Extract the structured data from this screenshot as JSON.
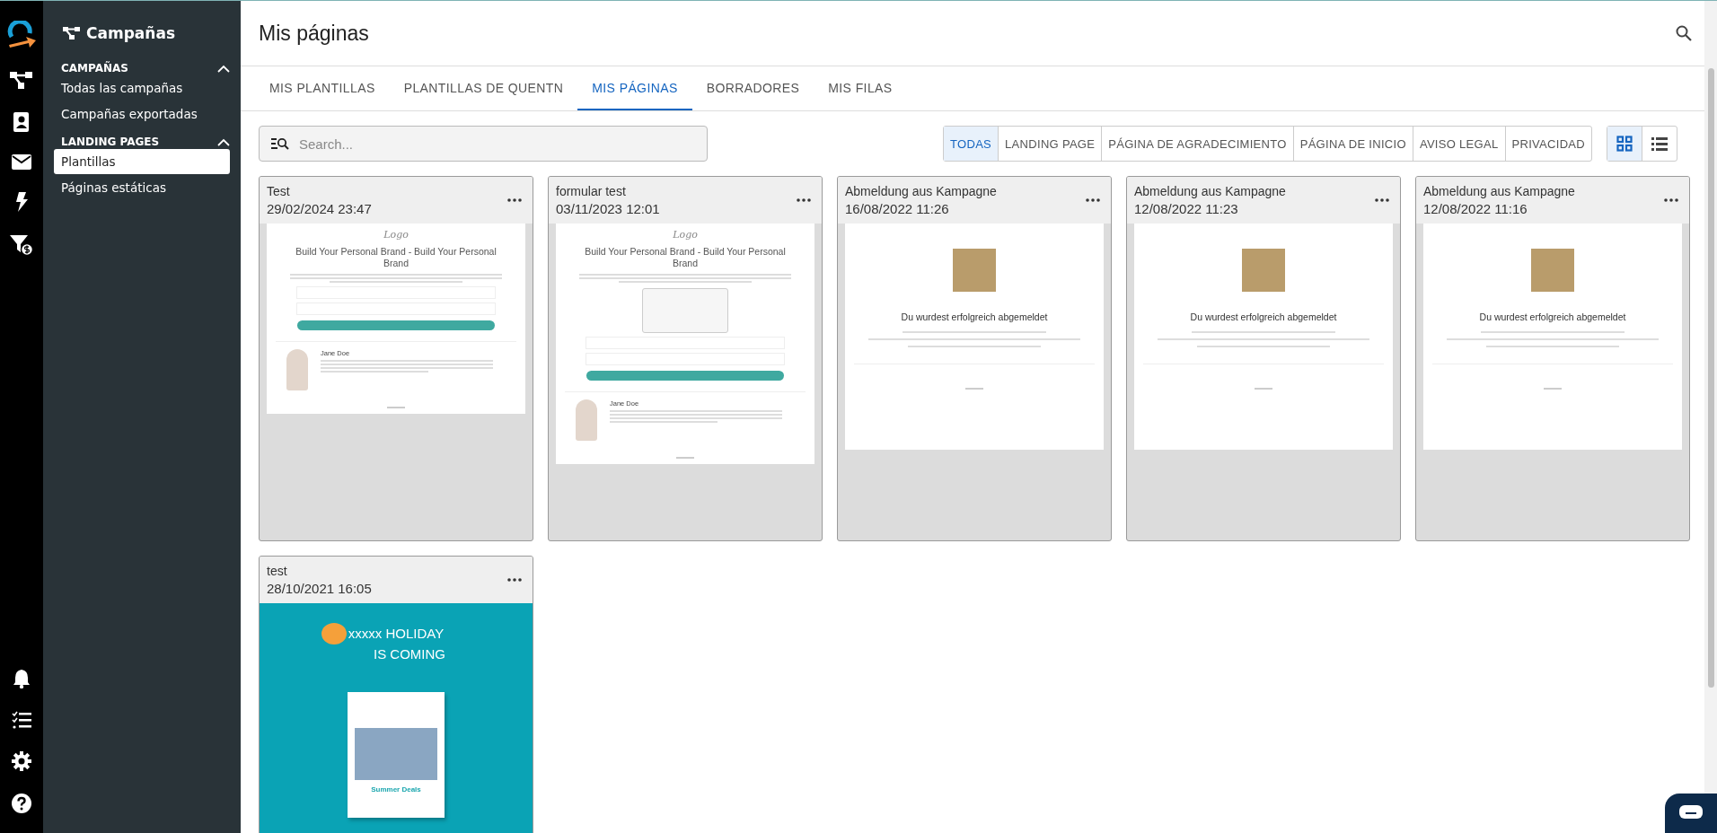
{
  "sidebar": {
    "title": "Campañas",
    "sections": [
      {
        "title": "CAMPAÑAS",
        "expanded": true,
        "items": [
          {
            "label": "Todas las campañas",
            "selected": false
          },
          {
            "label": "Campañas exportadas",
            "selected": false
          }
        ]
      },
      {
        "title": "LANDING PAGES",
        "expanded": true,
        "items": [
          {
            "label": "Plantillas",
            "selected": true
          },
          {
            "label": "Páginas estáticas",
            "selected": false
          }
        ]
      }
    ]
  },
  "header": {
    "title": "Mis páginas"
  },
  "tabs": [
    {
      "label": "MIS PLANTILLAS",
      "selected": false
    },
    {
      "label": "PLANTILLAS DE QUENTN",
      "selected": false
    },
    {
      "label": "MIS PÁGINAS",
      "selected": true
    },
    {
      "label": "BORRADORES",
      "selected": false
    },
    {
      "label": "MIS FILAS",
      "selected": false
    }
  ],
  "search": {
    "placeholder": "Search..."
  },
  "filters": [
    {
      "label": "TODAS",
      "selected": true
    },
    {
      "label": "LANDING PAGE",
      "selected": false
    },
    {
      "label": "PÁGINA DE AGRADECIMIENTO",
      "selected": false
    },
    {
      "label": "PÁGINA DE INICIO",
      "selected": false
    },
    {
      "label": "AVISO LEGAL",
      "selected": false
    },
    {
      "label": "PRIVACIDAD",
      "selected": false
    }
  ],
  "view_modes": [
    {
      "kind": "grid",
      "selected": true
    },
    {
      "kind": "list",
      "selected": false
    }
  ],
  "pages": [
    {
      "name": "Test",
      "date": "29/02/2024 23:47",
      "preview": {
        "kind": "brand",
        "logo": "Logo",
        "headline": "Build Your Personal Brand - Build Your Personal Brand",
        "author": "Jane Doe",
        "form": false
      }
    },
    {
      "name": "formular test",
      "date": "03/11/2023 12:01",
      "preview": {
        "kind": "brand",
        "logo": "Logo",
        "headline": "Build Your Personal Brand - Build Your Personal Brand",
        "author": "Jane Doe",
        "form": true
      }
    },
    {
      "name": "Abmeldung aus Kampagne",
      "date": "16/08/2022 11:26",
      "preview": {
        "kind": "unsubscribe",
        "headline": "Du wurdest erfolgreich abgemeldet"
      }
    },
    {
      "name": "Abmeldung aus Kampagne",
      "date": "12/08/2022 11:23",
      "preview": {
        "kind": "unsubscribe",
        "headline": "Du wurdest erfolgreich abgemeldet"
      }
    },
    {
      "name": "Abmeldung aus Kampagne",
      "date": "12/08/2022 11:16",
      "preview": {
        "kind": "unsubscribe",
        "headline": "Du wurdest erfolgreich abgemeldet"
      }
    },
    {
      "name": "test",
      "date": "28/10/2021 16:05",
      "preview": {
        "kind": "holiday",
        "headline": "xxxxx HOLIDAY",
        "subline": "IS COMING",
        "caption": "Summer Deals"
      }
    }
  ]
}
